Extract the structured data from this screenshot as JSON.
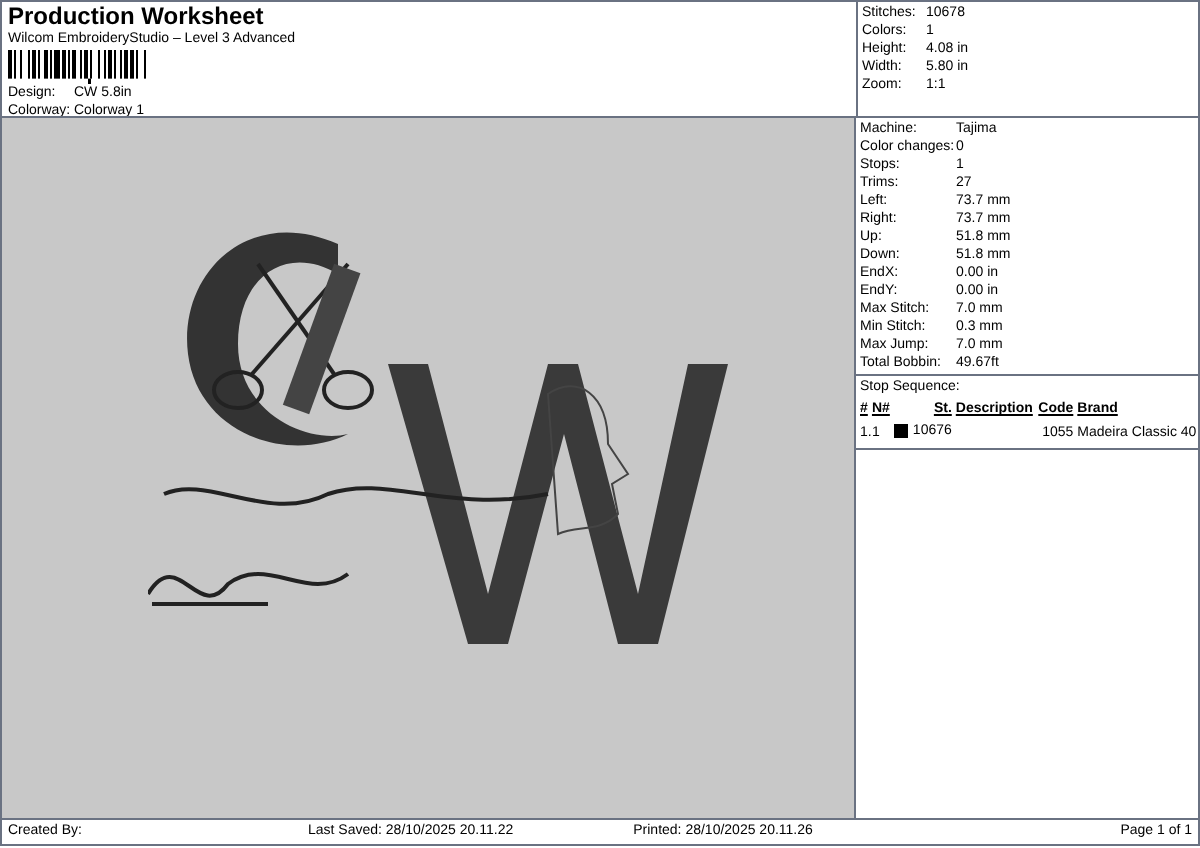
{
  "header": {
    "title": "Production Worksheet",
    "subtitle": "Wilcom EmbroideryStudio – Level 3 Advanced",
    "fields": [
      {
        "label": "Design:",
        "value": "CW 5.8in"
      },
      {
        "label": "Colorway:",
        "value": "Colorway 1"
      }
    ]
  },
  "summary": [
    {
      "label": "Stitches:",
      "value": "10678"
    },
    {
      "label": "Colors:",
      "value": "1"
    },
    {
      "label": "Height:",
      "value": "4.08 in"
    },
    {
      "label": "Width:",
      "value": "5.80 in"
    },
    {
      "label": "Zoom:",
      "value": "1:1"
    }
  ],
  "details": [
    {
      "label": "Machine:",
      "value": "Tajima"
    },
    {
      "label": "Color changes:",
      "value": "0"
    },
    {
      "label": "Stops:",
      "value": "1"
    },
    {
      "label": "Trims:",
      "value": "27"
    },
    {
      "label": "Left:",
      "value": "73.7 mm"
    },
    {
      "label": "Right:",
      "value": "73.7 mm"
    },
    {
      "label": "Up:",
      "value": "51.8 mm"
    },
    {
      "label": "Down:",
      "value": "51.8 mm"
    },
    {
      "label": "EndX:",
      "value": "0.00 in"
    },
    {
      "label": "EndY:",
      "value": "0.00 in"
    },
    {
      "label": "Max Stitch:",
      "value": "7.0 mm"
    },
    {
      "label": "Min Stitch:",
      "value": "0.3 mm"
    },
    {
      "label": "Max Jump:",
      "value": "7.0 mm"
    },
    {
      "label": "Total Bobbin:",
      "value": "49.67ft"
    }
  ],
  "stop_sequence": {
    "title": "Stop Sequence:",
    "columns": [
      "#",
      "N#",
      "St.",
      "Description",
      "Code",
      "Brand"
    ],
    "rows": [
      {
        "index": "1.",
        "needle": "1",
        "color": "#000000",
        "stitches": "10676",
        "code": "1055",
        "brand": "Madeira Classic 40"
      }
    ]
  },
  "footer": {
    "created_by": "Created By:",
    "last_saved": "Last Saved: 28/10/2025 20.11.22",
    "printed": "Printed: 28/10/2025 20.11.26",
    "page": "Page 1 of 1"
  }
}
